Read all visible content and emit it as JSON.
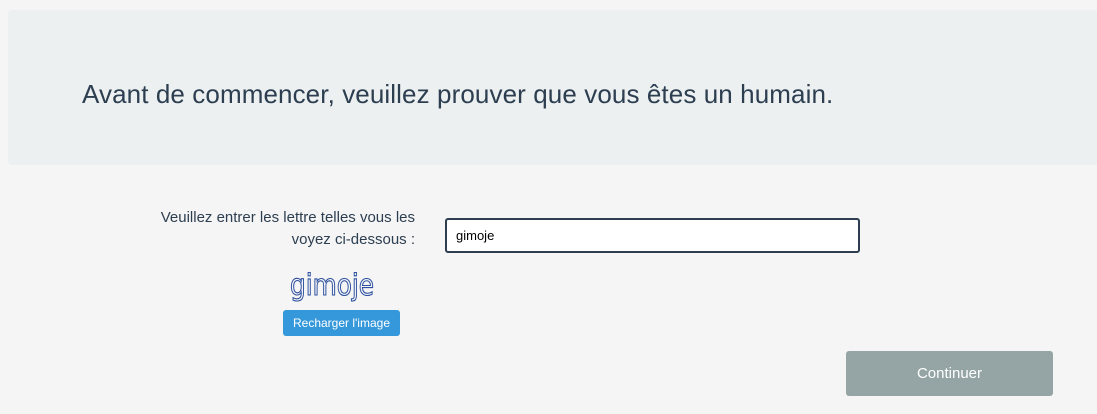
{
  "header": {
    "title": "Avant de commencer, veuillez prouver que vous êtes un humain."
  },
  "captcha": {
    "label": "Veuillez entrer les lettre telles vous les voyez ci-dessous :",
    "input_value": "gimoje",
    "image_text": "gimoje",
    "image_color": "#2b4ea0",
    "reload_label": "Recharger l'image"
  },
  "actions": {
    "continue_label": "Continuer"
  },
  "colors": {
    "hero_bg": "#ecf0f1",
    "text": "#2c3e50",
    "reload_bg": "#3498db",
    "continue_bg": "#95a5a6"
  }
}
